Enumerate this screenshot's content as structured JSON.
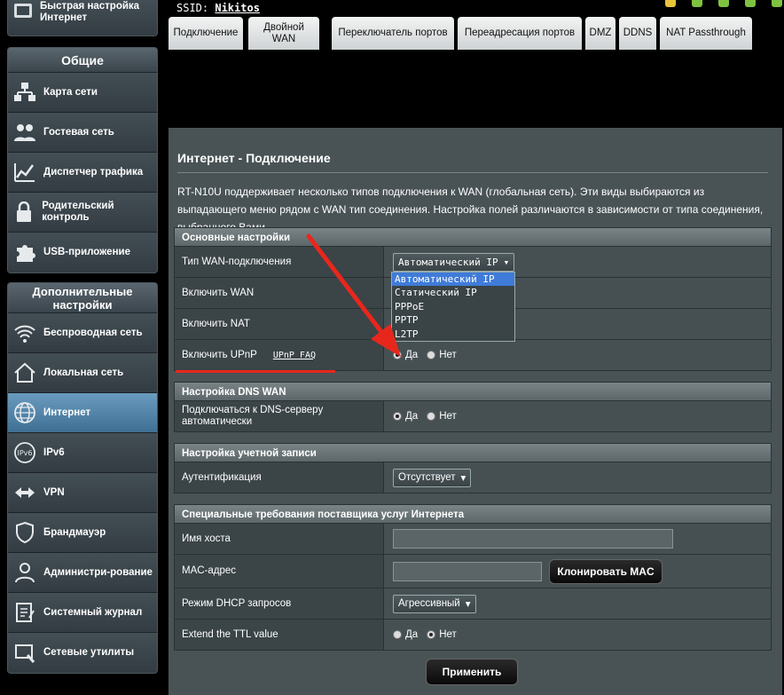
{
  "ssid": {
    "label": "SSID:",
    "value": "Nikitos"
  },
  "sidebar": {
    "quick": {
      "label": "Быстрая настройка Интернет"
    },
    "general": {
      "title": "Общие",
      "items": [
        {
          "label": "Карта сети",
          "icon": "network-map-icon"
        },
        {
          "label": "Гостевая сеть",
          "icon": "guest-network-icon"
        },
        {
          "label": "Диспетчер трафика",
          "icon": "traffic-manager-icon"
        },
        {
          "label": "Родительский контроль",
          "icon": "parental-control-icon"
        },
        {
          "label": "USB-приложение",
          "icon": "usb-app-icon"
        }
      ]
    },
    "advanced": {
      "title": "Дополнительные настройки",
      "items": [
        {
          "label": "Беспроводная сеть",
          "icon": "wireless-icon"
        },
        {
          "label": "Локальная сеть",
          "icon": "home-icon"
        },
        {
          "label": "Интернет",
          "icon": "globe-icon",
          "active": true
        },
        {
          "label": "IPv6",
          "icon": "ipv6-icon"
        },
        {
          "label": "VPN",
          "icon": "vpn-icon"
        },
        {
          "label": "Брандмауэр",
          "icon": "firewall-icon"
        },
        {
          "label": "Администри-рование",
          "icon": "admin-icon"
        },
        {
          "label": "Системный журнал",
          "icon": "log-icon"
        },
        {
          "label": "Сетевые утилиты",
          "icon": "tools-icon"
        }
      ]
    }
  },
  "tabs": [
    "Подключение",
    "Двойной WAN",
    "Переключатель портов",
    "Переадресация портов",
    "DMZ",
    "DDNS",
    "NAT Passthrough"
  ],
  "page": {
    "title": "Интернет - Подключение",
    "desc": "RT-N10U поддерживает несколько типов подключения к WAN (глобальная сеть). Эти виды выбираются из выпадающего меню рядом с WAN тип соединения. Настройка полей различаются в зависимости от типа соединения, выбранного Вами."
  },
  "basic": {
    "title": "Основные настройки",
    "wan_type_label": "Тип WAN-подключения",
    "wan_type_value": "Автоматический IP",
    "wan_type_options": [
      "Автоматический IP",
      "Статический IP",
      "PPPoE",
      "PPTP",
      "L2TP"
    ],
    "enable_wan": "Включить WAN",
    "enable_nat": "Включить NAT",
    "enable_upnp": "Включить UPnP",
    "upnp_faq": "UPnP FAQ",
    "yes": "Да",
    "no": "Нет"
  },
  "dns": {
    "title": "Настройка DNS WAN",
    "auto_label": "Подключаться к DNS-серверу автоматически",
    "yes": "Да",
    "no": "Нет"
  },
  "account": {
    "title": "Настройка учетной записи",
    "auth_label": "Аутентификация",
    "auth_value": "Отсутствует"
  },
  "isp": {
    "title": "Специальные требования поставщика услуг Интернета",
    "host_label": "Имя хоста",
    "mac_label": "MAC-адрес",
    "clone_mac": "Клонировать MAC",
    "dhcp_label": "Режим DHCP запросов",
    "dhcp_value": "Агрессивный",
    "ttl_label": "Extend the TTL value",
    "yes": "Да",
    "no": "Нет"
  },
  "apply": "Применить",
  "colors": {
    "accent": "#3f7bd8",
    "annotation": "#e8271c",
    "active_nav": "#4b7ca0"
  }
}
